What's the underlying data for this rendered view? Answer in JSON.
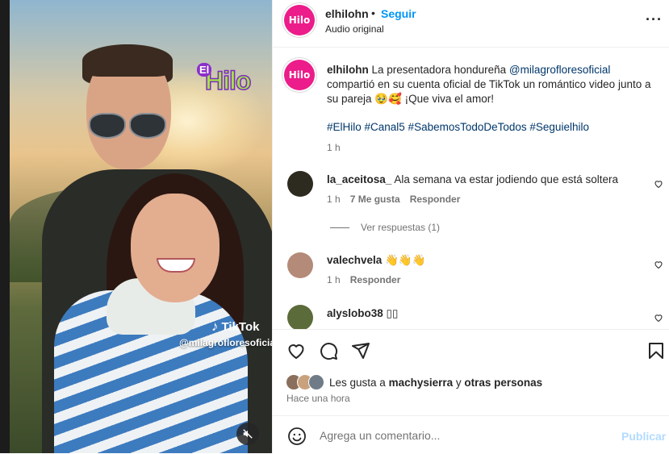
{
  "media": {
    "overlay_logo_el": "El",
    "overlay_logo_hilo": "Hilo",
    "watermark_brand": "TikTok",
    "watermark_user": "@milagrofloresoficial",
    "mute_icon": "speaker-muted-icon"
  },
  "header": {
    "avatar_text": "Hilo",
    "username": "elhilohn",
    "separator": "•",
    "follow_label": "Seguir",
    "audio_label": "Audio original",
    "more_icon": "more-horizontal-icon"
  },
  "caption": {
    "username": "elhilohn",
    "text_before": " La presentadora hondureña ",
    "mention": "@milagrofloresoficial",
    "text_after": " compartió en su cuenta oficial de TikTok un romántico video junto a su pareja 🥹🥰 ¡Que viva el amor!",
    "hashtags": "#ElHilo #Canal5 #SabemosTodoDeTodos #Seguielhilo",
    "time": "1 h"
  },
  "comments": [
    {
      "username": "la_aceitosa_",
      "text": " Ala semana va estar jodiendo que está soltera",
      "time": "1 h",
      "likes": "7 Me gusta",
      "reply_label": "Responder",
      "avatar_color": "#2d2a1f"
    },
    {
      "username": "valechvela",
      "text": " 👋👋👋",
      "time": "1 h",
      "reply_label": "Responder",
      "avatar_color": "#b48a78"
    },
    {
      "username": "alyslobo38",
      "text": " ▯▯",
      "avatar_color": "#5b6b3a"
    }
  ],
  "view_replies": "Ver respuestas (1)",
  "actions": {
    "like_icon": "heart-icon",
    "comment_icon": "comment-icon",
    "share_icon": "send-icon",
    "save_icon": "bookmark-icon"
  },
  "likes": {
    "prefix": "Les gusta a ",
    "user": "machysierra",
    "suffix": " y ",
    "others": "otras personas",
    "face_colors": [
      "#8a6f5c",
      "#c9a27d",
      "#6f7c88"
    ]
  },
  "posted_time": "Hace una hora",
  "composer": {
    "emoji_icon": "emoji-icon",
    "placeholder": "Agrega un comentario...",
    "publish_label": "Publicar"
  },
  "colors": {
    "accent": "#0095f6",
    "brand_pink": "#ec1c8a",
    "link": "#00376b"
  }
}
